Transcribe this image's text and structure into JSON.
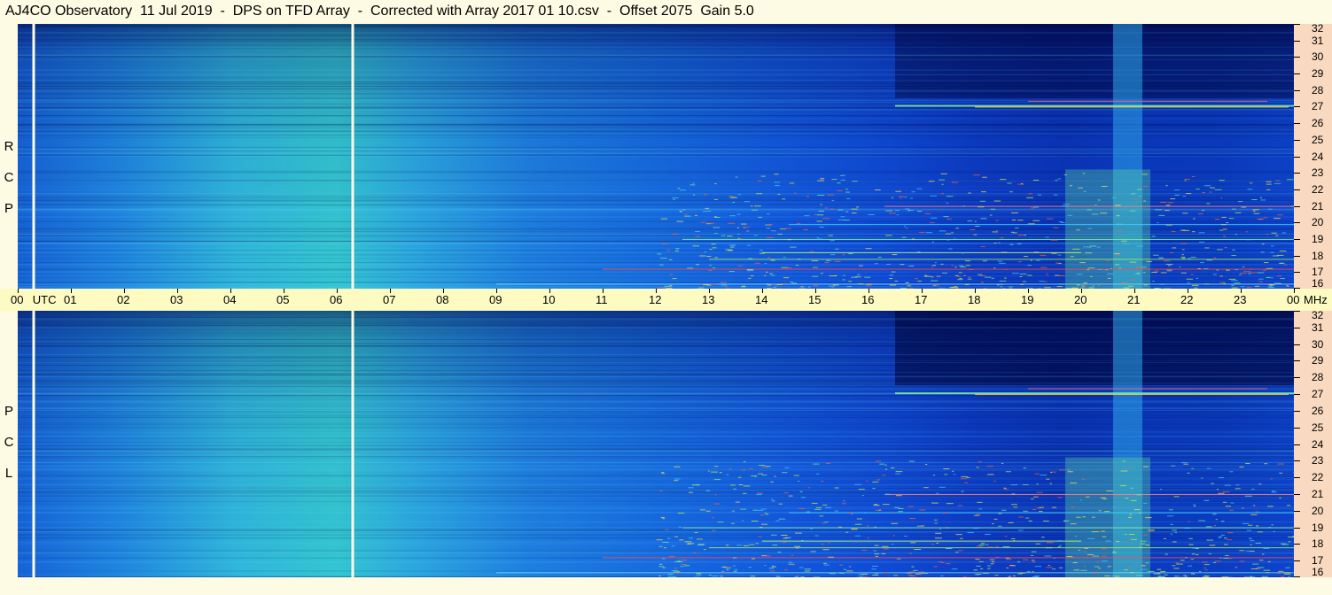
{
  "title": "AJ4CO Observatory  11 Jul 2019  -  DPS on TFD Array  -  Corrected with Array 2017 01 10.csv  -  Offset 2075  Gain 5.0",
  "panels": [
    {
      "pol_letters": [
        "R",
        "C",
        "P"
      ]
    },
    {
      "pol_letters": [
        "L",
        "C",
        "P"
      ]
    }
  ],
  "chart_data": {
    "type": "heatmap",
    "title": "AJ4CO Observatory  11 Jul 2019  -  DPS on TFD Array  -  Corrected with Array 2017 01 10.csv  -  Offset 2075  Gain 5.0",
    "x_axis": {
      "tick_labels": [
        "00",
        "01",
        "02",
        "03",
        "04",
        "05",
        "06",
        "07",
        "08",
        "09",
        "10",
        "11",
        "12",
        "13",
        "14",
        "15",
        "16",
        "17",
        "18",
        "19",
        "20",
        "21",
        "22",
        "23",
        "00"
      ],
      "unit_label": "UTC",
      "range": [
        0,
        24
      ]
    },
    "y_axis": {
      "tick_labels": [
        "32",
        "31",
        "30",
        "29",
        "28",
        "27",
        "26",
        "25",
        "24",
        "23",
        "22",
        "21",
        "20",
        "19",
        "18",
        "17",
        "16"
      ],
      "unit_label": "MHz",
      "range": [
        16,
        32
      ]
    },
    "series": [
      {
        "name": "RCP"
      },
      {
        "name": "LCP"
      }
    ],
    "colormap": [
      "#00004f",
      "#0a2fb8",
      "#1f7ee6",
      "#3fd8c8",
      "#d8f040",
      "#ff3020"
    ],
    "legend": "none"
  }
}
